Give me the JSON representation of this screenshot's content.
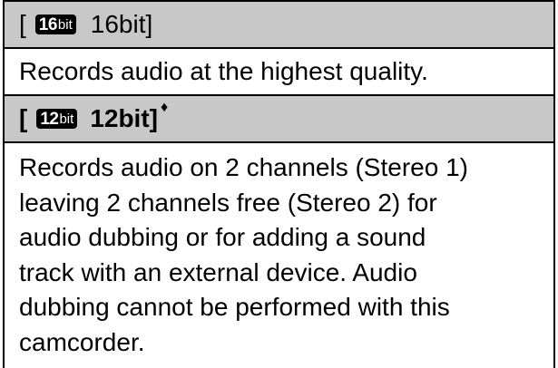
{
  "rows": [
    {
      "header": {
        "open_bracket": "[",
        "badge_number": "16",
        "badge_unit": "bit",
        "label": "16bit",
        "close_bracket": "]",
        "marker": ""
      },
      "description": "Records audio at the highest quality."
    },
    {
      "header": {
        "open_bracket": "[",
        "badge_number": "12",
        "badge_unit": "bit",
        "label": "12bit",
        "close_bracket": "]",
        "marker": "♦"
      },
      "description_lines": [
        "Records audio on 2 channels (Stereo 1)",
        "leaving 2 channels free (Stereo 2) for",
        "audio dubbing or for adding a sound",
        "track with an external device. Audio",
        "dubbing cannot be performed with this",
        "camcorder."
      ]
    }
  ],
  "colors": {
    "header_background": "#c8c8c8",
    "border": "#000000",
    "badge_background": "#000000",
    "badge_text": "#ffffff"
  },
  "icons": {
    "row_0_badge": "16bit-icon",
    "row_1_badge": "12bit-icon"
  }
}
